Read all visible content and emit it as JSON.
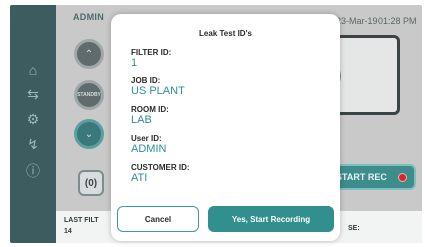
{
  "topbar": {
    "user": "ADMIN",
    "date": "2023-Mar-19",
    "time": "01:28 PM"
  },
  "sidebar": {
    "icons": [
      "home-icon",
      "transfer-arrows-icon",
      "settings-gear-icon",
      "pulse-icon",
      "help-icon"
    ]
  },
  "controls": {
    "standby_label": "STANDBY",
    "reset_label": "(0)",
    "start_rec_label": "START REC",
    "display_value": "0"
  },
  "bottom_bar": {
    "last_filter_label": "LAST FILT",
    "last_filter_value": "14",
    "right_label": "SE:"
  },
  "modal": {
    "title": "Leak Test ID's",
    "fields": [
      {
        "label": "FILTER ID:",
        "value": "1"
      },
      {
        "label": "JOB ID:",
        "value": "US PLANT"
      },
      {
        "label": "ROOM ID:",
        "value": "LAB"
      },
      {
        "label": "User ID:",
        "value": "ADMIN"
      },
      {
        "label": "CUSTOMER ID:",
        "value": "ATI"
      }
    ],
    "cancel_label": "Cancel",
    "confirm_label": "Yes, Start Recording"
  },
  "colors": {
    "accent": "#318f8e",
    "sidebar": "#3c5c5f",
    "record": "#d62828"
  }
}
